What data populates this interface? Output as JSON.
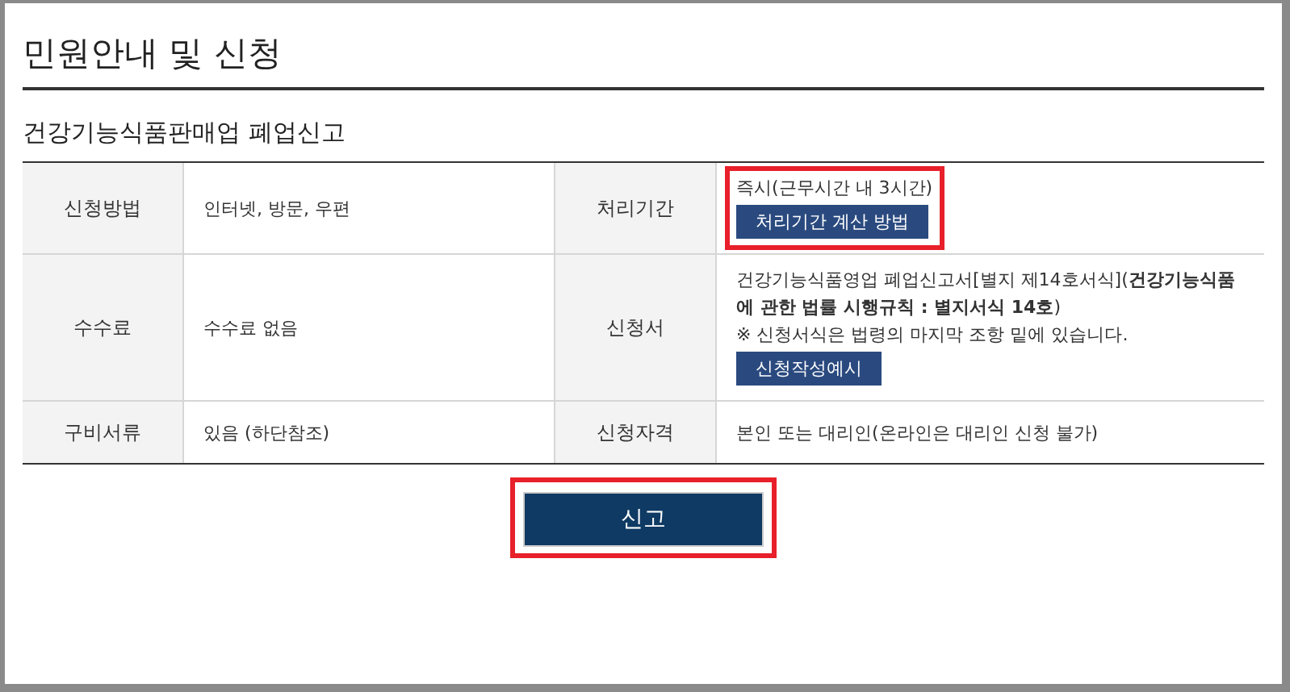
{
  "page_title": "민원안내 및 신청",
  "section_title": "건강기능식품판매업 폐업신고",
  "table": {
    "rows": [
      {
        "cells": [
          {
            "label": "신청방법",
            "highlighted": false,
            "content": [
              {
                "kind": "text",
                "text": "인터넷, 방문, 우편"
              }
            ]
          },
          {
            "label": "처리기간",
            "highlighted": true,
            "content": [
              {
                "kind": "text",
                "text": "즉시(근무시간 내 3시간)"
              },
              {
                "kind": "button",
                "text": "처리기간 계산 방법"
              }
            ]
          }
        ]
      },
      {
        "cells": [
          {
            "label": "수수료",
            "highlighted": false,
            "content": [
              {
                "kind": "text",
                "text": "수수료 없음"
              }
            ]
          },
          {
            "label": "신청서",
            "highlighted": false,
            "content": [
              {
                "kind": "text",
                "text": "건강기능식품영업 폐업신고서[별지 제14호서식](**건강기능식품에 관한 법률 시행규칙 : 별지서식 14호**)"
              },
              {
                "kind": "text",
                "text": "※ 신청서식은 법령의 마지막 조항 밑에 있습니다."
              },
              {
                "kind": "button",
                "text": "신청작성예시"
              }
            ]
          }
        ]
      },
      {
        "cells": [
          {
            "label": "구비서류",
            "highlighted": false,
            "content": [
              {
                "kind": "text",
                "text": "있음 (하단참조)"
              }
            ]
          },
          {
            "label": "신청자격",
            "highlighted": false,
            "content": [
              {
                "kind": "text",
                "text": "본인 또는 대리인(온라인은 대리인 신청 불가)"
              }
            ]
          }
        ]
      }
    ]
  },
  "submit": {
    "label": "신고",
    "highlighted": true
  }
}
